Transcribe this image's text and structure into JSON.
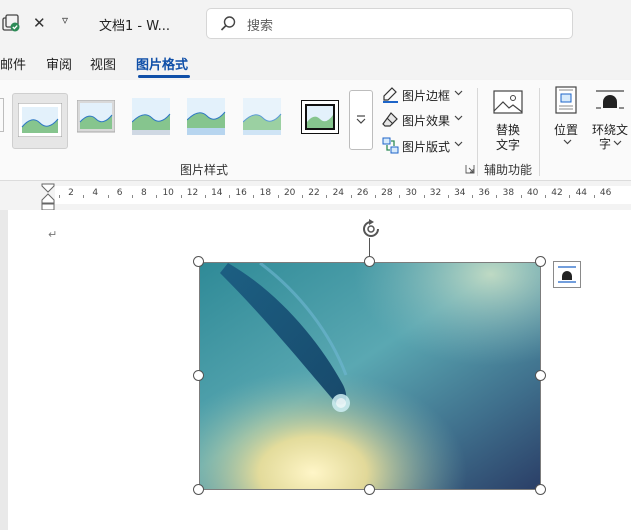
{
  "titlebar": {
    "doc_title": "文档1  -  W...",
    "search_placeholder": "搜索",
    "close_glyph": "✕",
    "more_glyph": "▿"
  },
  "tabs": [
    {
      "label": "邮件",
      "active": false
    },
    {
      "label": "审阅",
      "active": false
    },
    {
      "label": "视图",
      "active": false
    },
    {
      "label": "图片格式",
      "active": true
    }
  ],
  "ribbon": {
    "picture_styles": {
      "group_label": "图片样式",
      "commands": [
        {
          "label": "图片边框",
          "icon": "pen-border-icon"
        },
        {
          "label": "图片效果",
          "icon": "eraser-effects-icon"
        },
        {
          "label": "图片版式",
          "icon": "picture-layout-icon"
        }
      ]
    },
    "accessibility": {
      "group_label": "辅助功能",
      "alt_text_line1": "替换",
      "alt_text_line2": "文字"
    },
    "arrange": {
      "position_label": "位置",
      "wrap_text_line1": "环绕文",
      "wrap_text_line2": "字"
    }
  },
  "ruler": {
    "numbers": [
      "2",
      "4",
      "6",
      "8",
      "10",
      "12",
      "14",
      "16",
      "18",
      "20",
      "22",
      "24",
      "26",
      "28",
      "30",
      "32",
      "34",
      "36",
      "38",
      "40",
      "42",
      "44",
      "46"
    ]
  },
  "document": {
    "paragraph_mark": "↵"
  },
  "colors": {
    "accent": "#0f4fa8",
    "ribbon_bg": "#fafafa",
    "titlebar_bg": "#f3f3f3"
  }
}
